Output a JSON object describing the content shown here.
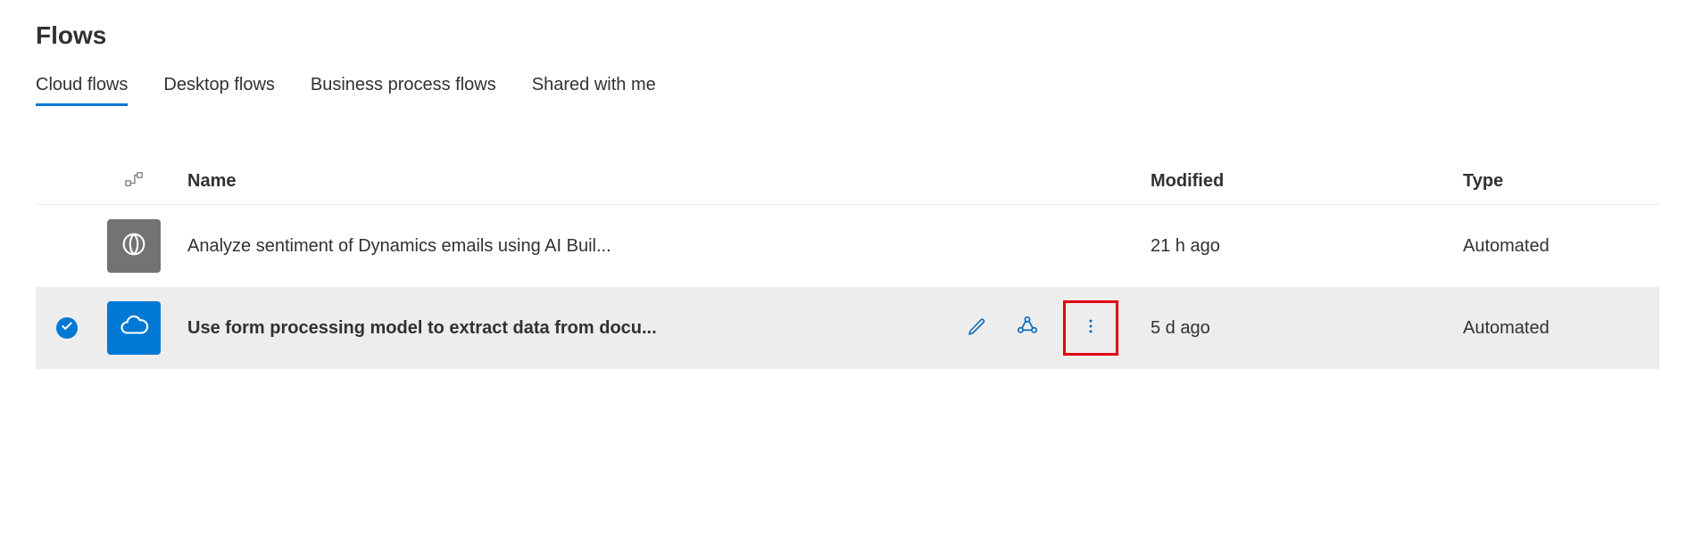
{
  "page": {
    "title": "Flows"
  },
  "tabs": [
    {
      "label": "Cloud flows",
      "active": true
    },
    {
      "label": "Desktop flows",
      "active": false
    },
    {
      "label": "Business process flows",
      "active": false
    },
    {
      "label": "Shared with me",
      "active": false
    }
  ],
  "columns": {
    "name": "Name",
    "modified": "Modified",
    "type": "Type"
  },
  "rows": [
    {
      "selected": false,
      "tile_color": "gray",
      "icon": "dynamics-icon",
      "name": "Analyze sentiment of Dynamics emails using AI Buil...",
      "modified": "21 h ago",
      "type": "Automated"
    },
    {
      "selected": true,
      "tile_color": "blue",
      "icon": "onedrive-icon",
      "name": "Use form processing model to extract data from docu...",
      "modified": "5 d ago",
      "type": "Automated"
    }
  ],
  "colors": {
    "accent": "#0078D4",
    "highlight_border": "#e3000f"
  }
}
